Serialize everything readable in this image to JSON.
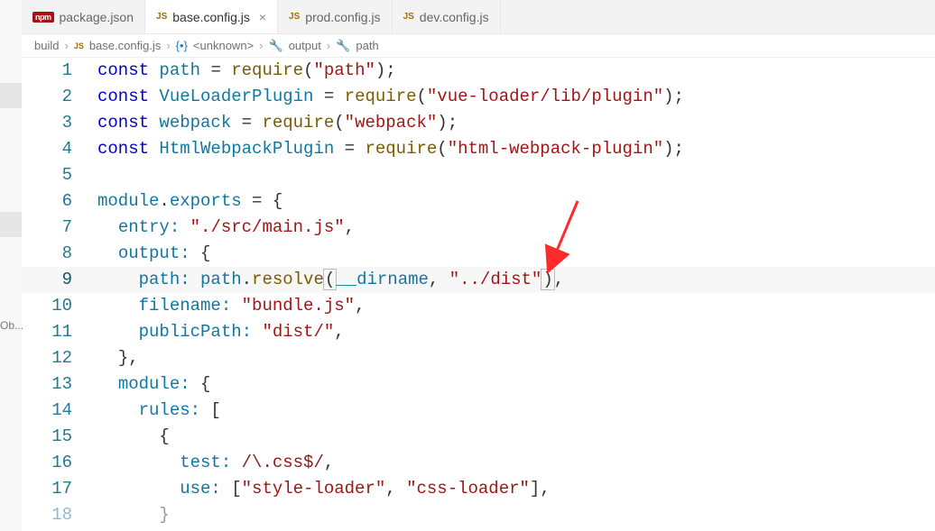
{
  "tabs": [
    {
      "icon": "npm",
      "label": "package.json",
      "active": false
    },
    {
      "icon": "js",
      "label": "base.config.js",
      "active": true
    },
    {
      "icon": "js",
      "label": "prod.config.js",
      "active": false
    },
    {
      "icon": "js",
      "label": "dev.config.js",
      "active": false
    }
  ],
  "breadcrumbs": {
    "folder": "build",
    "file": "base.config.js",
    "namespace": "<unknown>",
    "prop1": "output",
    "prop2": "path"
  },
  "code": {
    "l1": {
      "t1": "const",
      "t2": " path ",
      "t3": "=",
      "t4": " require",
      "t5": "(",
      "t6": "\"path\"",
      "t7": ");"
    },
    "l2": {
      "t1": "const",
      "t2": " VueLoaderPlugin ",
      "t3": "=",
      "t4": " require",
      "t5": "(",
      "t6": "\"vue-loader/lib/plugin\"",
      "t7": ");"
    },
    "l3": {
      "t1": "const",
      "t2": " webpack ",
      "t3": "=",
      "t4": " require",
      "t5": "(",
      "t6": "\"webpack\"",
      "t7": ");"
    },
    "l4": {
      "t1": "const",
      "t2": " HtmlWebpackPlugin ",
      "t3": "=",
      "t4": " require",
      "t5": "(",
      "t6": "\"html-webpack-plugin\"",
      "t7": ");"
    },
    "l5": {
      "t1": ""
    },
    "l6": {
      "t1": "module",
      "t2": ".",
      "t3": "exports",
      "t4": " = {"
    },
    "l7": {
      "ind": "  ",
      "t1": "entry:",
      "t2": " ",
      "t3": "\"./src/main.js\"",
      "t4": ","
    },
    "l8": {
      "ind": "  ",
      "t1": "output:",
      "t2": " {"
    },
    "l9": {
      "ind": "    ",
      "t1": "path:",
      "t2": " path",
      "t3": ".",
      "t4": "resolve",
      "t5": "(",
      "t6": "__dirname",
      "t7": ", ",
      "t8": "\"../dist\"",
      "t9": ")",
      "t10": ","
    },
    "l10": {
      "ind": "    ",
      "t1": "filename:",
      "t2": " ",
      "t3": "\"bundle.js\"",
      "t4": ","
    },
    "l11": {
      "ind": "    ",
      "t1": "publicPath:",
      "t2": " ",
      "t3": "\"dist/\"",
      "t4": ","
    },
    "l12": {
      "ind": "  ",
      "t1": "},"
    },
    "l13": {
      "ind": "  ",
      "t1": "module:",
      "t2": " {"
    },
    "l14": {
      "ind": "    ",
      "t1": "rules:",
      "t2": " ["
    },
    "l15": {
      "ind": "      ",
      "t1": "{"
    },
    "l16": {
      "ind": "        ",
      "t1": "test:",
      "t2": " ",
      "t3": "/\\.css$/",
      "t4": ","
    },
    "l17": {
      "ind": "        ",
      "t1": "use:",
      "t2": " [",
      "t3": "\"style-loader\"",
      "t4": ", ",
      "t5": "\"css-loader\"",
      "t6": "],"
    },
    "l18": {
      "ind": "      ",
      "t1": "}"
    }
  },
  "lineNumbers": [
    "1",
    "2",
    "3",
    "4",
    "5",
    "6",
    "7",
    "8",
    "9",
    "10",
    "11",
    "12",
    "13",
    "14",
    "15",
    "16",
    "17",
    "18"
  ],
  "leftStripLabel": "Ob...",
  "arrowColor": "#ff2b2b"
}
